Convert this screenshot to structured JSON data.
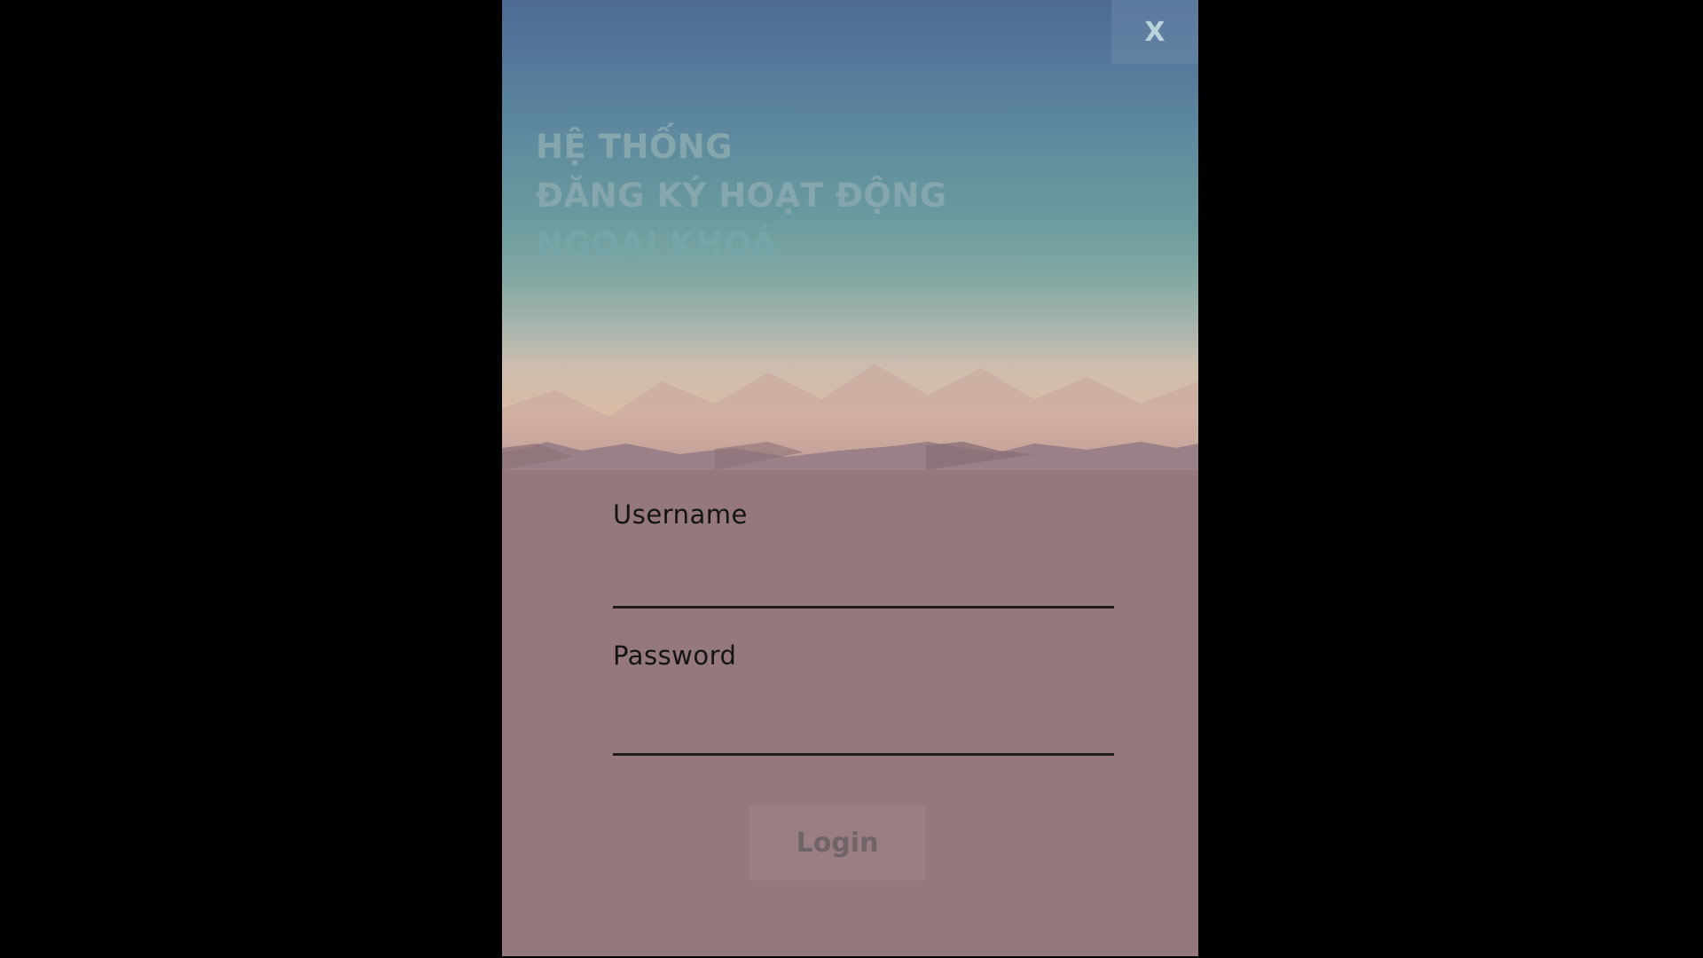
{
  "window": {
    "close_label": "X",
    "title_lines": [
      "HỆ THỐNG",
      "ĐĂNG KÝ HOẠT ĐỘNG",
      "NGOẠI KHOÁ"
    ]
  },
  "form": {
    "username_label": "Username",
    "username_value": "",
    "password_label": "Password",
    "password_value": "",
    "login_label": "Login"
  },
  "colors": {
    "panel_background": "#94787c",
    "page_background": "#000000",
    "banner_top": "#4e6a92",
    "banner_bottom": "#d9bca6"
  }
}
